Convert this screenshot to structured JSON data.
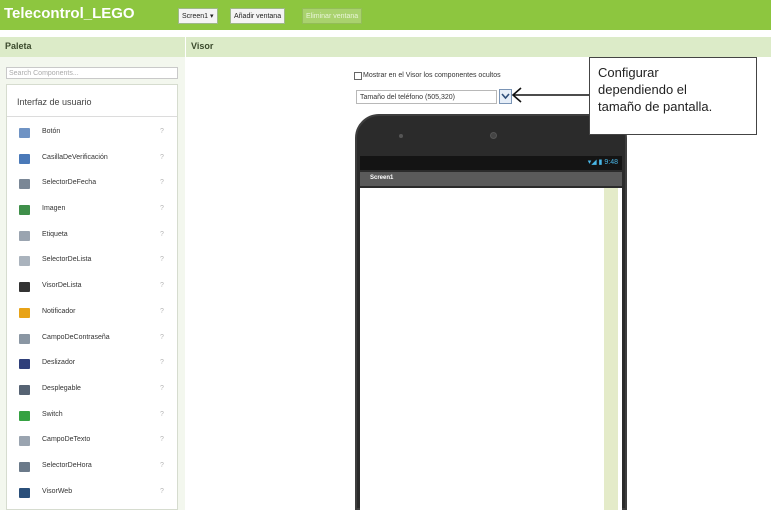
{
  "topbar": {
    "project_name": "Telecontrol_LEGO",
    "screen_selector": "Screen1 ▾",
    "add_screen": "Añadir ventana",
    "remove_screen": "Eliminar ventana"
  },
  "palette": {
    "title": "Paleta",
    "search_placeholder": "Search Components...",
    "group_title": "Interfaz de usuario",
    "help_icon_glyph": "?",
    "components": [
      {
        "label": "Botón",
        "icon": "button-icon",
        "color": "#6f93c4"
      },
      {
        "label": "CasillaDeVerificación",
        "icon": "checkbox-icon",
        "color": "#4a79b8"
      },
      {
        "label": "SelectorDeFecha",
        "icon": "calendar-icon",
        "color": "#7a8796"
      },
      {
        "label": "Imagen",
        "icon": "image-icon",
        "color": "#3f8f4a"
      },
      {
        "label": "Etiqueta",
        "icon": "label-icon",
        "color": "#9aa4b0"
      },
      {
        "label": "SelectorDeLista",
        "icon": "list-picker-icon",
        "color": "#aab3bd"
      },
      {
        "label": "VisorDeLista",
        "icon": "list-view-icon",
        "color": "#333333"
      },
      {
        "label": "Notificador",
        "icon": "warning-icon",
        "color": "#e8a317"
      },
      {
        "label": "CampoDeContraseña",
        "icon": "password-icon",
        "color": "#8a96a3"
      },
      {
        "label": "Deslizador",
        "icon": "slider-icon",
        "color": "#2f3f7a"
      },
      {
        "label": "Desplegable",
        "icon": "spinner-icon",
        "color": "#566373"
      },
      {
        "label": "Switch",
        "icon": "switch-icon",
        "color": "#35a142"
      },
      {
        "label": "CampoDeTexto",
        "icon": "textbox-icon",
        "color": "#9aa4b0"
      },
      {
        "label": "SelectorDeHora",
        "icon": "clock-icon",
        "color": "#6b7a8a"
      },
      {
        "label": "VisorWeb",
        "icon": "globe-icon",
        "color": "#2a4f7a"
      }
    ]
  },
  "viewer": {
    "title": "Visor",
    "show_hidden_label": "Mostrar en el Visor los componentes ocultos",
    "size_select_value": "Tamaño del teléfono (505,320)",
    "size_select_arrow": "⌄"
  },
  "phone": {
    "status_time": "9:48",
    "status_icons": "▾◢ ▮",
    "screen_title": "Screen1"
  },
  "callout": {
    "lines": [
      "Configurar",
      "dependiendo el",
      "tamaño de pantalla."
    ]
  },
  "colors": {
    "topbar": "#8dc63f",
    "section_bar": "#dcebc8",
    "palette_bg": "#f3f7ee",
    "phone_body": "#2b2b2b",
    "status_icon": "#49b6e6"
  }
}
